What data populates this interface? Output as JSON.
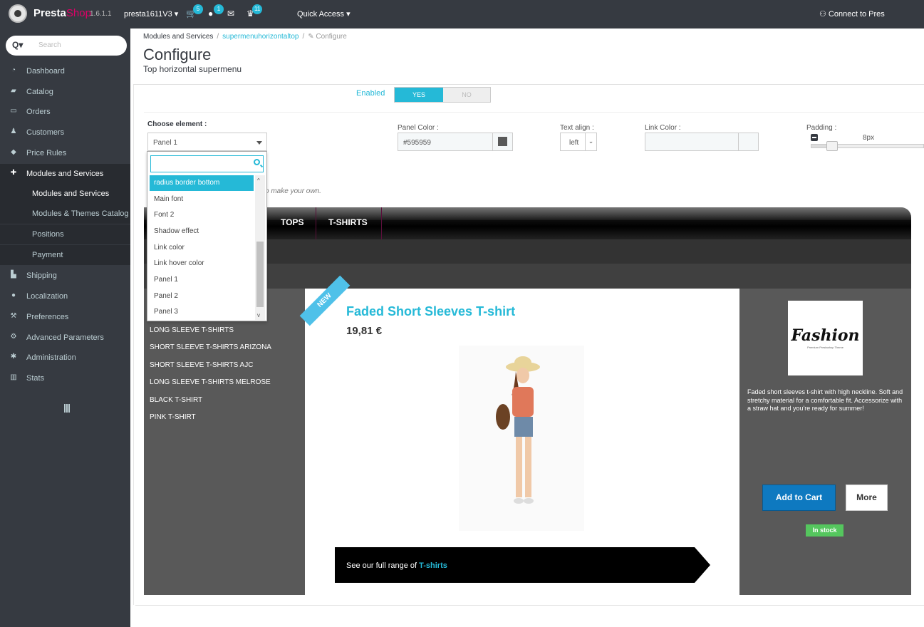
{
  "topbar": {
    "brand_main": "Presta",
    "brand_accent": "Shop",
    "version": "1.6.1.1",
    "shop_name": "presta1611V3",
    "badges": {
      "orders": "5",
      "customers": "1",
      "trophies": "11"
    },
    "quick_access": "Quick Access",
    "connect": "Connect to Pres"
  },
  "sidebar": {
    "search_placeholder": "Search",
    "items": [
      {
        "label": "Dashboard",
        "icon": "dashboard-icon"
      },
      {
        "label": "Catalog",
        "icon": "book-icon"
      },
      {
        "label": "Orders",
        "icon": "credit-card-icon"
      },
      {
        "label": "Customers",
        "icon": "users-icon"
      },
      {
        "label": "Price Rules",
        "icon": "tag-icon"
      },
      {
        "label": "Modules and Services",
        "icon": "puzzle-icon"
      },
      {
        "label": "Shipping",
        "icon": "truck-icon"
      },
      {
        "label": "Localization",
        "icon": "globe-icon"
      },
      {
        "label": "Preferences",
        "icon": "wrench-icon"
      },
      {
        "label": "Advanced Parameters",
        "icon": "cogs-icon"
      },
      {
        "label": "Administration",
        "icon": "gear-icon"
      },
      {
        "label": "Stats",
        "icon": "bar-chart-icon"
      }
    ],
    "subitems": [
      "Modules and Services",
      "Modules & Themes Catalog",
      "Positions",
      "Payment"
    ]
  },
  "header": {
    "breadcrumb": [
      "Modules and Services",
      "supermenuhorizontaltop",
      "Configure"
    ],
    "title": "Configure",
    "subtitle": "Top horizontal supermenu"
  },
  "form": {
    "enabled_label": "Enabled",
    "yes": "YES",
    "no": "NO",
    "choose_label": "Choose element :",
    "choose_value": "Panel 1",
    "panel_color_label": "Panel Color :",
    "panel_color_value": "#595959",
    "text_align_label": "Text align :",
    "text_align_value": "left",
    "link_color_label": "Link Color :",
    "padding_label": "Padding :",
    "padding_value": "8px",
    "help_text": "o make your own."
  },
  "dropdown": {
    "items": [
      "radius border bottom",
      "Main font",
      "Font 2",
      "Shadow effect",
      "Link color",
      "Link hover color",
      "Panel 1",
      "Panel 2",
      "Panel 3"
    ],
    "highlighted": "radius border bottom"
  },
  "preview": {
    "tabs": [
      "TOPS",
      "T-SHIRTS"
    ],
    "left_links": [
      "LONG SLEEVE T-SHIRTS",
      "SHORT SLEEVE T-SHIRTS ARIZONA",
      "SHORT SLEEVE T-SHIRTS AJC",
      "LONG SLEEVE T-SHIRTS MELROSE",
      "BLACK T-SHIRT",
      "PINK T-SHIRT"
    ],
    "ribbon": "NEW",
    "product_title": "Faded Short Sleeves T-shirt",
    "product_price": "19,81 €",
    "cta_prefix": "See our full range of ",
    "cta_link": "T-shirts",
    "brand_logo": "Fashion",
    "brand_logo_sub": "Premium Prestashop Theme",
    "description": "Faded short sleeves t-shirt with high neckline. Soft and stretchy material for a comfortable fit. Accessorize with a straw hat and you're ready for summer!",
    "add_to_cart": "Add to Cart",
    "more": "More",
    "stock": "In stock"
  },
  "colors": {
    "accent": "#25b9d7",
    "sidebar": "#363a41",
    "panel": "#595959"
  }
}
